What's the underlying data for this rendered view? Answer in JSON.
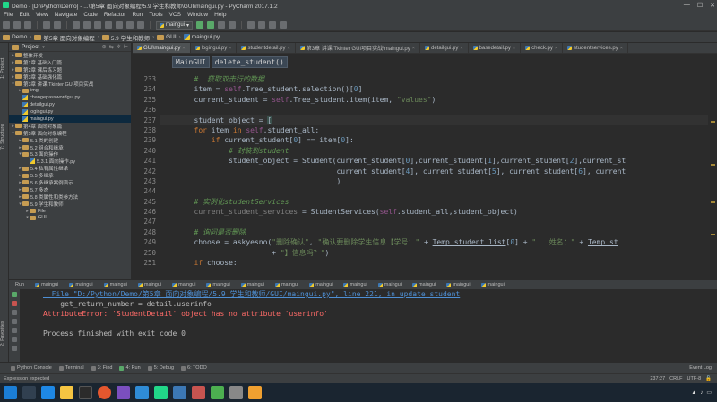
{
  "window": {
    "title": "Demo - [D:\\Python\\Demo] - ...\\第5章 面向对象编程\\5.9 学生和教师\\GUI\\maingui.py - PyCharm 2017.1.2",
    "controls": [
      "—",
      "☐",
      "✕"
    ]
  },
  "menu": [
    "File",
    "Edit",
    "View",
    "Navigate",
    "Code",
    "Refactor",
    "Run",
    "Tools",
    "VCS",
    "Window",
    "Help"
  ],
  "toolbar": {
    "run_config": "maingui"
  },
  "breadcrumb": [
    "Demo",
    "第5章 面向对象编程",
    "5.9 学生和教师",
    "GUI",
    "maingui.py"
  ],
  "project_panel": {
    "title": "Project",
    "items": [
      {
        "label": "整体开发",
        "type": "folder",
        "indent": 0,
        "arrow": "▸"
      },
      {
        "label": "第1章 基础入门篇",
        "type": "folder",
        "indent": 0,
        "arrow": "▸"
      },
      {
        "label": "第2章 课后练习题",
        "type": "folder",
        "indent": 0,
        "arrow": "▸"
      },
      {
        "label": "第3章 基础强化篇",
        "type": "folder",
        "indent": 0,
        "arrow": "▸"
      },
      {
        "label": "第3章 讲课 Tkinter GUI项目实战",
        "type": "folder",
        "indent": 0,
        "arrow": "▾"
      },
      {
        "label": "img",
        "type": "folder",
        "indent": 1,
        "arrow": "▸"
      },
      {
        "label": "changepasswordgui.py",
        "type": "py",
        "indent": 1,
        "arrow": ""
      },
      {
        "label": "detailgui.py",
        "type": "py",
        "indent": 1,
        "arrow": ""
      },
      {
        "label": "logingui.py",
        "type": "py",
        "indent": 1,
        "arrow": ""
      },
      {
        "label": "maingui.py",
        "type": "py",
        "indent": 1,
        "arrow": "",
        "selected": true
      },
      {
        "label": "第4章 面向对象篇",
        "type": "folder",
        "indent": 0,
        "arrow": "▸"
      },
      {
        "label": "第5章 面向对象编程",
        "type": "folder",
        "indent": 0,
        "arrow": "▾"
      },
      {
        "label": "5.1 类的创建",
        "type": "folder",
        "indent": 1,
        "arrow": "▸"
      },
      {
        "label": "5.2 组合和继承",
        "type": "folder",
        "indent": 1,
        "arrow": "▸"
      },
      {
        "label": "5.3 面向操作",
        "type": "folder",
        "indent": 1,
        "arrow": "▾"
      },
      {
        "label": "5.3.1 面向操作.py",
        "type": "py",
        "indent": 2,
        "arrow": ""
      },
      {
        "label": "5.4 私有属性继承",
        "type": "folder",
        "indent": 1,
        "arrow": "▸"
      },
      {
        "label": "5.5 多继承",
        "type": "folder",
        "indent": 1,
        "arrow": "▸"
      },
      {
        "label": "5.6 多继承案例演示",
        "type": "folder",
        "indent": 1,
        "arrow": "▸"
      },
      {
        "label": "5.7 多态",
        "type": "folder",
        "indent": 1,
        "arrow": "▸"
      },
      {
        "label": "5.8 类属性和类参方法",
        "type": "folder",
        "indent": 1,
        "arrow": "▸"
      },
      {
        "label": "5.9 学生和教师",
        "type": "folder",
        "indent": 1,
        "arrow": "▾"
      },
      {
        "label": "File",
        "type": "folder",
        "indent": 2,
        "arrow": "▸"
      },
      {
        "label": "GUI",
        "type": "folder",
        "indent": 2,
        "arrow": "▾"
      }
    ]
  },
  "tabs": [
    {
      "label": "GUI\\maingui.py",
      "active": true
    },
    {
      "label": "logingui.py"
    },
    {
      "label": "studentdetail.py"
    },
    {
      "label": "第3章 讲课 Tkinter GUI项目实战\\maingui.py"
    },
    {
      "label": "detailgui.py"
    },
    {
      "label": "basedetail.py"
    },
    {
      "label": "check.py"
    },
    {
      "label": "studentservices.py"
    }
  ],
  "editor": {
    "breadcrumb": [
      "MainGUI",
      "delete_student()"
    ],
    "line_numbers": [
      "233",
      "234",
      "235",
      "236",
      "237",
      "238",
      "239",
      "240",
      "241",
      "242",
      "243",
      "244",
      "245",
      "246",
      "247",
      "248",
      "249",
      "250",
      "251"
    ]
  },
  "run_panel": {
    "title": "Run",
    "tabs": [
      "maingui",
      "maingui",
      "maingui",
      "maingui",
      "maingui",
      "maingui",
      "maingui",
      "maingui",
      "maingui",
      "maingui",
      "maingui",
      "maingui",
      "maingui",
      "maingui"
    ],
    "lines": [
      {
        "text": "  File \"D:/Python/Demo/第5章 面向对象编程/5.9 学生和教师/GUI/maingui.py\", line 221, in update_student",
        "kind": "link"
      },
      {
        "text": "    get_return_number = detail.userinfo",
        "kind": "normal"
      },
      {
        "text": "AttributeError: 'StudentDetail' object has no attribute 'userinfo'",
        "kind": "err"
      },
      {
        "text": "",
        "kind": "normal"
      },
      {
        "text": "Process finished with exit code 0",
        "kind": "normal"
      }
    ]
  },
  "tool_windows": [
    "Python Console",
    "Terminal",
    "3: Find",
    "4: Run",
    "5: Debug",
    "6: TODO"
  ],
  "event_log": "Event Log",
  "status": {
    "message": "Expression expected",
    "position": "237:27",
    "line_sep": "CRLF",
    "encoding": "UTF-8"
  },
  "left_strip": [
    "1: Project",
    "7: Structure",
    "2: Favorites"
  ]
}
